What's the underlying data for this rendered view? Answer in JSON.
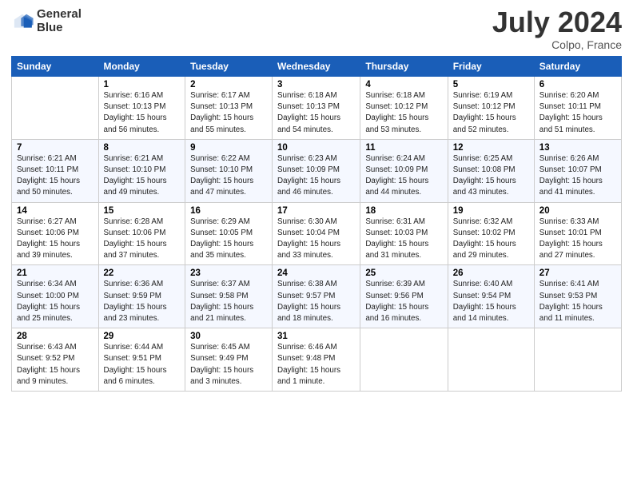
{
  "logo": {
    "line1": "General",
    "line2": "Blue"
  },
  "title": {
    "month_year": "July 2024",
    "location": "Colpo, France"
  },
  "headers": [
    "Sunday",
    "Monday",
    "Tuesday",
    "Wednesday",
    "Thursday",
    "Friday",
    "Saturday"
  ],
  "weeks": [
    [
      {
        "day": "",
        "sunrise": "",
        "sunset": "",
        "daylight": ""
      },
      {
        "day": "1",
        "sunrise": "Sunrise: 6:16 AM",
        "sunset": "Sunset: 10:13 PM",
        "daylight": "Daylight: 15 hours and 56 minutes."
      },
      {
        "day": "2",
        "sunrise": "Sunrise: 6:17 AM",
        "sunset": "Sunset: 10:13 PM",
        "daylight": "Daylight: 15 hours and 55 minutes."
      },
      {
        "day": "3",
        "sunrise": "Sunrise: 6:18 AM",
        "sunset": "Sunset: 10:13 PM",
        "daylight": "Daylight: 15 hours and 54 minutes."
      },
      {
        "day": "4",
        "sunrise": "Sunrise: 6:18 AM",
        "sunset": "Sunset: 10:12 PM",
        "daylight": "Daylight: 15 hours and 53 minutes."
      },
      {
        "day": "5",
        "sunrise": "Sunrise: 6:19 AM",
        "sunset": "Sunset: 10:12 PM",
        "daylight": "Daylight: 15 hours and 52 minutes."
      },
      {
        "day": "6",
        "sunrise": "Sunrise: 6:20 AM",
        "sunset": "Sunset: 10:11 PM",
        "daylight": "Daylight: 15 hours and 51 minutes."
      }
    ],
    [
      {
        "day": "7",
        "sunrise": "Sunrise: 6:21 AM",
        "sunset": "Sunset: 10:11 PM",
        "daylight": "Daylight: 15 hours and 50 minutes."
      },
      {
        "day": "8",
        "sunrise": "Sunrise: 6:21 AM",
        "sunset": "Sunset: 10:10 PM",
        "daylight": "Daylight: 15 hours and 49 minutes."
      },
      {
        "day": "9",
        "sunrise": "Sunrise: 6:22 AM",
        "sunset": "Sunset: 10:10 PM",
        "daylight": "Daylight: 15 hours and 47 minutes."
      },
      {
        "day": "10",
        "sunrise": "Sunrise: 6:23 AM",
        "sunset": "Sunset: 10:09 PM",
        "daylight": "Daylight: 15 hours and 46 minutes."
      },
      {
        "day": "11",
        "sunrise": "Sunrise: 6:24 AM",
        "sunset": "Sunset: 10:09 PM",
        "daylight": "Daylight: 15 hours and 44 minutes."
      },
      {
        "day": "12",
        "sunrise": "Sunrise: 6:25 AM",
        "sunset": "Sunset: 10:08 PM",
        "daylight": "Daylight: 15 hours and 43 minutes."
      },
      {
        "day": "13",
        "sunrise": "Sunrise: 6:26 AM",
        "sunset": "Sunset: 10:07 PM",
        "daylight": "Daylight: 15 hours and 41 minutes."
      }
    ],
    [
      {
        "day": "14",
        "sunrise": "Sunrise: 6:27 AM",
        "sunset": "Sunset: 10:06 PM",
        "daylight": "Daylight: 15 hours and 39 minutes."
      },
      {
        "day": "15",
        "sunrise": "Sunrise: 6:28 AM",
        "sunset": "Sunset: 10:06 PM",
        "daylight": "Daylight: 15 hours and 37 minutes."
      },
      {
        "day": "16",
        "sunrise": "Sunrise: 6:29 AM",
        "sunset": "Sunset: 10:05 PM",
        "daylight": "Daylight: 15 hours and 35 minutes."
      },
      {
        "day": "17",
        "sunrise": "Sunrise: 6:30 AM",
        "sunset": "Sunset: 10:04 PM",
        "daylight": "Daylight: 15 hours and 33 minutes."
      },
      {
        "day": "18",
        "sunrise": "Sunrise: 6:31 AM",
        "sunset": "Sunset: 10:03 PM",
        "daylight": "Daylight: 15 hours and 31 minutes."
      },
      {
        "day": "19",
        "sunrise": "Sunrise: 6:32 AM",
        "sunset": "Sunset: 10:02 PM",
        "daylight": "Daylight: 15 hours and 29 minutes."
      },
      {
        "day": "20",
        "sunrise": "Sunrise: 6:33 AM",
        "sunset": "Sunset: 10:01 PM",
        "daylight": "Daylight: 15 hours and 27 minutes."
      }
    ],
    [
      {
        "day": "21",
        "sunrise": "Sunrise: 6:34 AM",
        "sunset": "Sunset: 10:00 PM",
        "daylight": "Daylight: 15 hours and 25 minutes."
      },
      {
        "day": "22",
        "sunrise": "Sunrise: 6:36 AM",
        "sunset": "Sunset: 9:59 PM",
        "daylight": "Daylight: 15 hours and 23 minutes."
      },
      {
        "day": "23",
        "sunrise": "Sunrise: 6:37 AM",
        "sunset": "Sunset: 9:58 PM",
        "daylight": "Daylight: 15 hours and 21 minutes."
      },
      {
        "day": "24",
        "sunrise": "Sunrise: 6:38 AM",
        "sunset": "Sunset: 9:57 PM",
        "daylight": "Daylight: 15 hours and 18 minutes."
      },
      {
        "day": "25",
        "sunrise": "Sunrise: 6:39 AM",
        "sunset": "Sunset: 9:56 PM",
        "daylight": "Daylight: 15 hours and 16 minutes."
      },
      {
        "day": "26",
        "sunrise": "Sunrise: 6:40 AM",
        "sunset": "Sunset: 9:54 PM",
        "daylight": "Daylight: 15 hours and 14 minutes."
      },
      {
        "day": "27",
        "sunrise": "Sunrise: 6:41 AM",
        "sunset": "Sunset: 9:53 PM",
        "daylight": "Daylight: 15 hours and 11 minutes."
      }
    ],
    [
      {
        "day": "28",
        "sunrise": "Sunrise: 6:43 AM",
        "sunset": "Sunset: 9:52 PM",
        "daylight": "Daylight: 15 hours and 9 minutes."
      },
      {
        "day": "29",
        "sunrise": "Sunrise: 6:44 AM",
        "sunset": "Sunset: 9:51 PM",
        "daylight": "Daylight: 15 hours and 6 minutes."
      },
      {
        "day": "30",
        "sunrise": "Sunrise: 6:45 AM",
        "sunset": "Sunset: 9:49 PM",
        "daylight": "Daylight: 15 hours and 3 minutes."
      },
      {
        "day": "31",
        "sunrise": "Sunrise: 6:46 AM",
        "sunset": "Sunset: 9:48 PM",
        "daylight": "Daylight: 15 hours and 1 minute."
      },
      {
        "day": "",
        "sunrise": "",
        "sunset": "",
        "daylight": ""
      },
      {
        "day": "",
        "sunrise": "",
        "sunset": "",
        "daylight": ""
      },
      {
        "day": "",
        "sunrise": "",
        "sunset": "",
        "daylight": ""
      }
    ]
  ]
}
